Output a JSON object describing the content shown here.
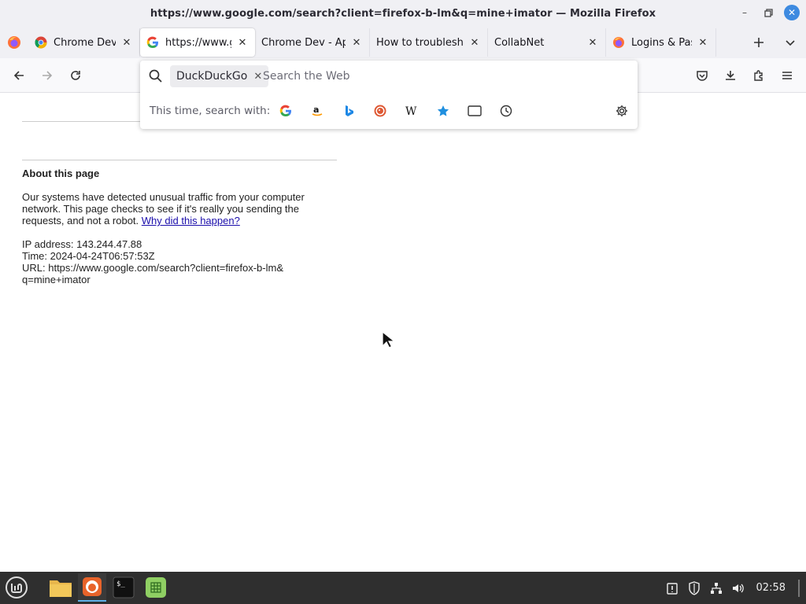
{
  "window": {
    "title": "https://www.google.com/search?client=firefox-b-lm&q=mine+imator — Mozilla Firefox"
  },
  "tabs": [
    {
      "label": "Chrome Dev",
      "icon": "chrome-icon",
      "active": false
    },
    {
      "label": "https://www.google.com",
      "icon": "google-icon",
      "active": true
    },
    {
      "label": "Chrome Dev - Apps",
      "icon": "none",
      "active": false
    },
    {
      "label": "How to troubleshoot",
      "icon": "none",
      "active": false
    },
    {
      "label": "CollabNet",
      "icon": "none",
      "active": false
    },
    {
      "label": "Logins & Passwords",
      "icon": "firefox-icon",
      "active": false
    }
  ],
  "search": {
    "engine_chip": "DuckDuckGo",
    "placeholder": "Search the Web",
    "oneoff_label": "This time, search with:",
    "engines": [
      "google-icon",
      "amazon-icon",
      "bing-icon",
      "duckduckgo-icon",
      "wikipedia-icon",
      "bookmarks-icon",
      "tabs-icon",
      "history-icon"
    ]
  },
  "page": {
    "about_title": "About this page",
    "about_body": "Our systems have detected unusual traffic from your computer network. This page checks to see if it's really you sending the requests, and not a robot.",
    "about_link": "Why did this happen?",
    "ip_line": "IP address: 143.244.47.88",
    "time_line": "Time: 2024-04-24T06:57:53Z",
    "url_line_1": "URL: https://www.google.com/search?client=firefox-b-lm&",
    "url_line_2": "q=mine+imator"
  },
  "taskbar": {
    "clock": "02:58"
  },
  "colors": {
    "link": "#1a0dab",
    "firefox_accent": "#3d8ae0",
    "taskbar_bg": "#2f2f2f"
  }
}
